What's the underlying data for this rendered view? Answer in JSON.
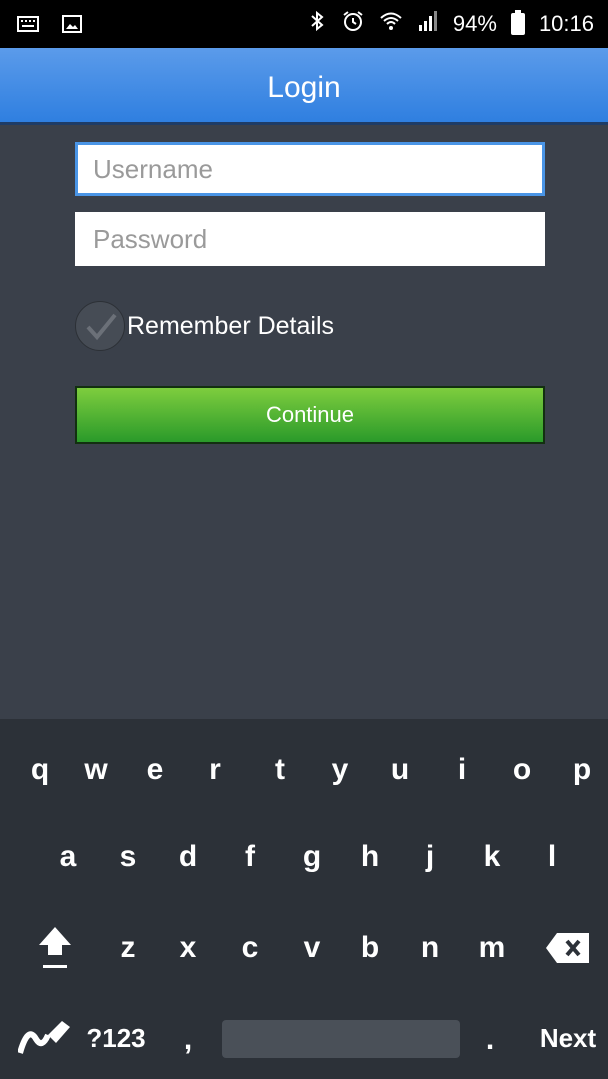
{
  "status_bar": {
    "icons_left": [
      "keyboard-icon",
      "image-icon"
    ],
    "icons_right": [
      "bluetooth-icon",
      "alarm-icon",
      "wifi-icon",
      "signal-icon"
    ],
    "battery": "94%",
    "time": "10:16"
  },
  "header": {
    "title": "Login"
  },
  "form": {
    "username_placeholder": "Username",
    "password_placeholder": "Password",
    "remember_label": "Remember Details",
    "remember_checked": true,
    "continue_label": "Continue"
  },
  "keyboard": {
    "row1": [
      "q",
      "w",
      "e",
      "r",
      "t",
      "y",
      "u",
      "i",
      "o",
      "p"
    ],
    "row2": [
      "a",
      "s",
      "d",
      "f",
      "g",
      "h",
      "j",
      "k",
      "l"
    ],
    "row3": [
      "z",
      "x",
      "c",
      "v",
      "b",
      "n",
      "m"
    ],
    "symbols_label": "?123",
    "comma": ",",
    "period": ".",
    "next_label": "Next"
  },
  "colors": {
    "header_blue": "#2f7fe0",
    "background": "#3a404a",
    "button_green": "#44ad2f",
    "keyboard_bg": "#2c3138"
  }
}
